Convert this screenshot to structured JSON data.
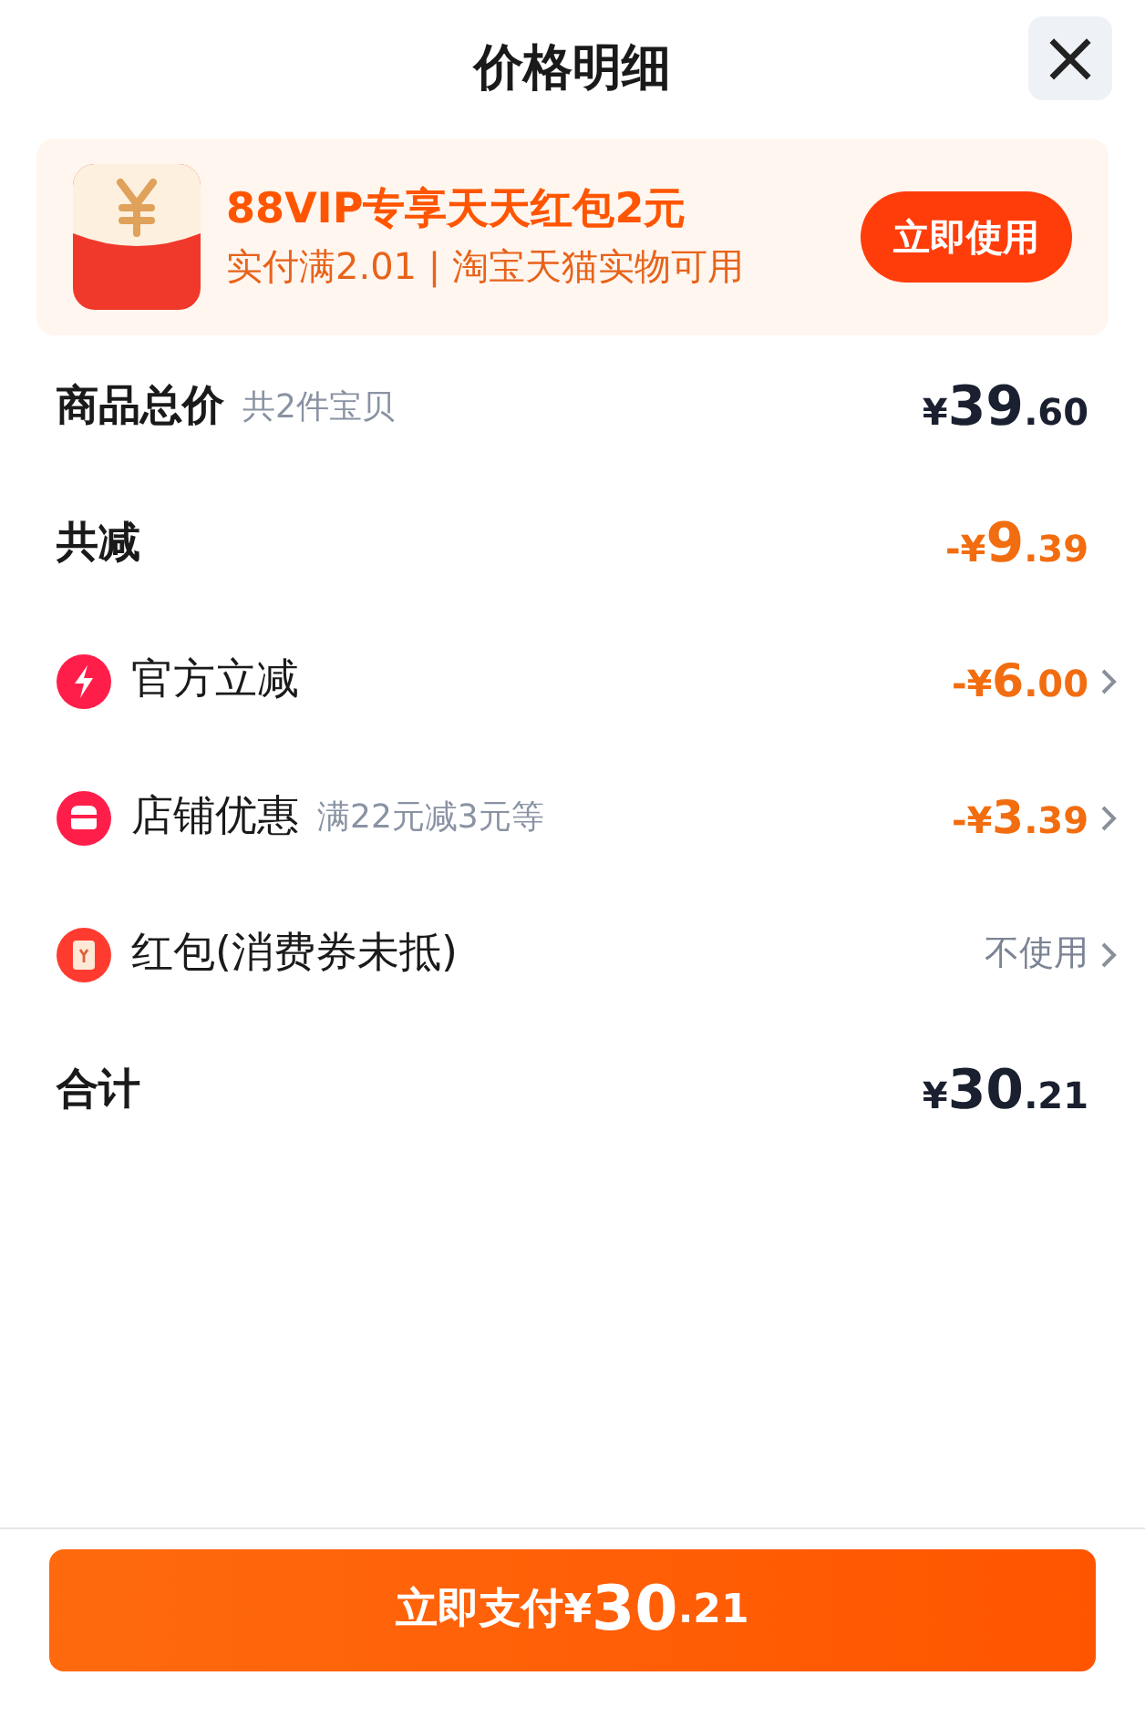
{
  "header": {
    "title": "价格明细",
    "close": "×"
  },
  "promo": {
    "title": "88VIP专享天天红包2元",
    "subtitle": "实付满2.01 | 淘宝天猫实物可用",
    "button": "立即使用"
  },
  "rows": [
    {
      "kind": "sum",
      "label": "商品总价",
      "note": "共2件宝贝",
      "amount": "¥39.60"
    },
    {
      "kind": "reduction_sum",
      "label": "共减",
      "amount": "-¥9.39"
    },
    {
      "kind": "reduction",
      "label": "官方立减",
      "amount": "-¥6.00"
    },
    {
      "kind": "reduction",
      "label": "店铺优惠",
      "note": "满22元减3元等",
      "amount": "-¥3.39"
    },
    {
      "kind": "option",
      "label": "红包(消费券未抵)",
      "value": "不使用"
    },
    {
      "kind": "sum",
      "label": "合计",
      "amount": "¥30.21"
    }
  ],
  "pay_button": {
    "label": "立即支付",
    "amount": "¥30.21"
  }
}
